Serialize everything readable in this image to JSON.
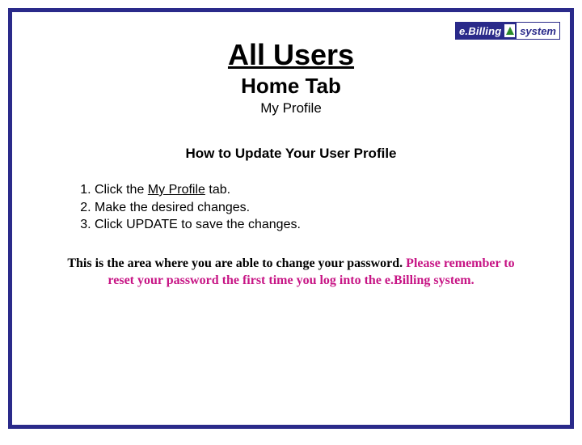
{
  "logo": {
    "left": "e.Billing",
    "right": "system"
  },
  "title": "All Users",
  "subtitle": "Home Tab",
  "subsubtitle": "My Profile",
  "section_heading": "How to Update Your User Profile",
  "steps": {
    "s1a": "Click the ",
    "s1b": "My Profile",
    "s1c": " tab.",
    "s2": "Make the desired changes.",
    "s3": "Click UPDATE to save the changes."
  },
  "note": {
    "black": "This is the area where you are able to change your password. ",
    "pink": "Please remember to reset your password the first time you log into the e.Billing system."
  }
}
